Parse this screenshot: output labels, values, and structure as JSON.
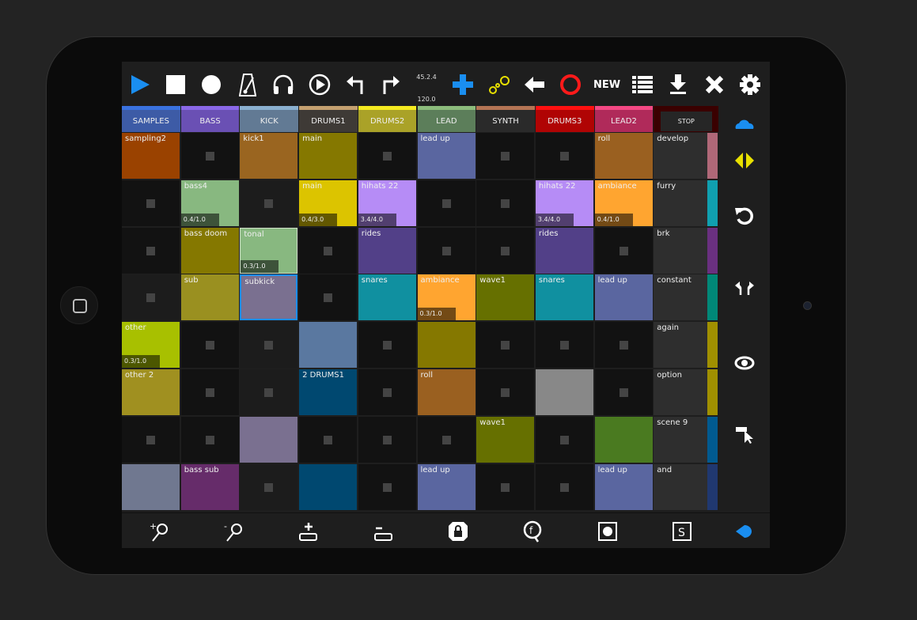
{
  "toolbar": {
    "position": "45.2.4",
    "tempo": "120.0",
    "new_label": "NEW",
    "icons": [
      "play-icon",
      "stop-icon",
      "record-icon",
      "metronome-icon",
      "headphones-icon",
      "play-circle-icon",
      "undo-icon",
      "redo-icon",
      "add-icon",
      "chain-icon",
      "back-arrow-icon",
      "arm-record-icon",
      "list-icon",
      "download-icon",
      "close-icon",
      "gear-icon"
    ]
  },
  "colors": {
    "accent": "#1a8ef0",
    "record": "#ff1a1a",
    "chain": "#e8e000"
  },
  "tracks": [
    {
      "name": "SAMPLES",
      "strip": "#3a72e0",
      "body": "#3d5ba6"
    },
    {
      "name": "BASS",
      "strip": "#8a68e8",
      "body": "#6a50b4"
    },
    {
      "name": "KICK",
      "strip": "#8ab0d0",
      "body": "#627a94"
    },
    {
      "name": "DRUMS1",
      "strip": "#c4a070",
      "body": "#3e3a36"
    },
    {
      "name": "DRUMS2",
      "strip": "#f4ea20",
      "body": "#aaa228"
    },
    {
      "name": "LEAD",
      "strip": "#8cbc7c",
      "body": "#5c7e5a"
    },
    {
      "name": "SYNTH",
      "strip": "#b47454",
      "body": "#2a2a2a"
    },
    {
      "name": "DRUMS3",
      "strip": "#ff1010",
      "body": "#b00404"
    },
    {
      "name": "LEAD2",
      "strip": "#f44884",
      "body": "#b02a5a"
    },
    {
      "name": "STOP",
      "strip": "#3a0000",
      "body": "#262626"
    }
  ],
  "rows": [
    {
      "scene": "develop",
      "scene_color": "#b06878",
      "clips": [
        {
          "name": "sampling2",
          "color": "#9a4200"
        },
        null,
        {
          "name": "kick1",
          "color": "#9a6520"
        },
        {
          "name": "main",
          "color": "#857800"
        },
        null,
        {
          "name": "lead up",
          "color": "#5a66a0"
        },
        null,
        null,
        {
          "name": "roll",
          "color": "#9a6020"
        }
      ]
    },
    {
      "scene": "furry",
      "scene_color": "#10a0b0",
      "clips": [
        null,
        {
          "name": "bass4",
          "color": "#88b880",
          "progress": "0.4/1.0"
        },
        null,
        {
          "name": "main",
          "color": "#dcc400",
          "progress": "0.4/3.0"
        },
        {
          "name": "hihats 22",
          "color": "#b68cf6",
          "progress": "3.4/4.0"
        },
        null,
        null,
        {
          "name": "hihats 22",
          "color": "#b68cf6",
          "progress": "3.4/4.0"
        },
        {
          "name": "ambiance",
          "color": "#ffa530",
          "progress": "0.4/1.0"
        }
      ]
    },
    {
      "scene": "brk",
      "scene_color": "#6a3080",
      "clips": [
        null,
        {
          "name": "bass doom",
          "color": "#857800"
        },
        {
          "name": "tonal",
          "color": "#88b880",
          "progress": "0.3/1.0",
          "selected": true
        },
        null,
        {
          "name": "rides",
          "color": "#524088"
        },
        null,
        null,
        {
          "name": "rides",
          "color": "#524088"
        },
        null
      ]
    },
    {
      "scene": "constant",
      "scene_color": "#008878",
      "clips": [
        null,
        {
          "name": "sub",
          "color": "#9a9020"
        },
        {
          "name": "subkick",
          "color": "#7a7090",
          "focused": true
        },
        null,
        {
          "name": "snares",
          "color": "#1090a0"
        },
        {
          "name": "ambiance",
          "color": "#ffa530",
          "progress": "0.3/1.0"
        },
        {
          "name": "wave1",
          "color": "#667000"
        },
        {
          "name": "snares",
          "color": "#1090a0"
        },
        {
          "name": "lead up",
          "color": "#5a66a0"
        }
      ]
    },
    {
      "scene": "again",
      "scene_color": "#a09000",
      "clips": [
        {
          "name": "other",
          "color": "#a8c000",
          "progress": "0.3/1.0"
        },
        null,
        null,
        {
          "name": "",
          "color": "#5a78a0"
        },
        null,
        {
          "name": "",
          "color": "#857800"
        },
        null,
        null,
        null
      ]
    },
    {
      "scene": "option",
      "scene_color": "#a09000",
      "clips": [
        {
          "name": "other 2",
          "color": "#a09020"
        },
        null,
        null,
        {
          "name": "2 DRUMS1",
          "color": "#004870"
        },
        null,
        {
          "name": "roll",
          "color": "#9a6020"
        },
        null,
        {
          "name": "",
          "color": "#888888"
        },
        null
      ]
    },
    {
      "scene": "scene 9",
      "scene_color": "#005a90",
      "clips": [
        null,
        null,
        {
          "name": "",
          "color": "#7a7090"
        },
        null,
        null,
        null,
        {
          "name": "wave1",
          "color": "#667000"
        },
        null,
        {
          "name": "",
          "color": "#4a7a20"
        }
      ]
    },
    {
      "scene": "and",
      "scene_color": "#203870",
      "clips": [
        {
          "name": "",
          "color": "#707890"
        },
        {
          "name": "bass sub",
          "color": "#662c6a"
        },
        null,
        {
          "name": "",
          "color": "#004870"
        },
        null,
        {
          "name": "lead up",
          "color": "#5a66a0"
        },
        null,
        null,
        {
          "name": "lead up",
          "color": "#5a66a0"
        }
      ]
    }
  ],
  "sidebar": {
    "icons": [
      "cloud-icon",
      "swap-arrows-icon",
      "refresh-icon",
      "undo-redo-icon",
      "eye-icon",
      "select-cursor-icon"
    ]
  },
  "bottombar": {
    "icons": [
      "zoom-in-icon",
      "zoom-out-icon",
      "add-row-icon",
      "remove-row-icon",
      "lock-icon",
      "follow-icon",
      "record-square-icon",
      "session-icon",
      "blue-drop-icon"
    ]
  }
}
